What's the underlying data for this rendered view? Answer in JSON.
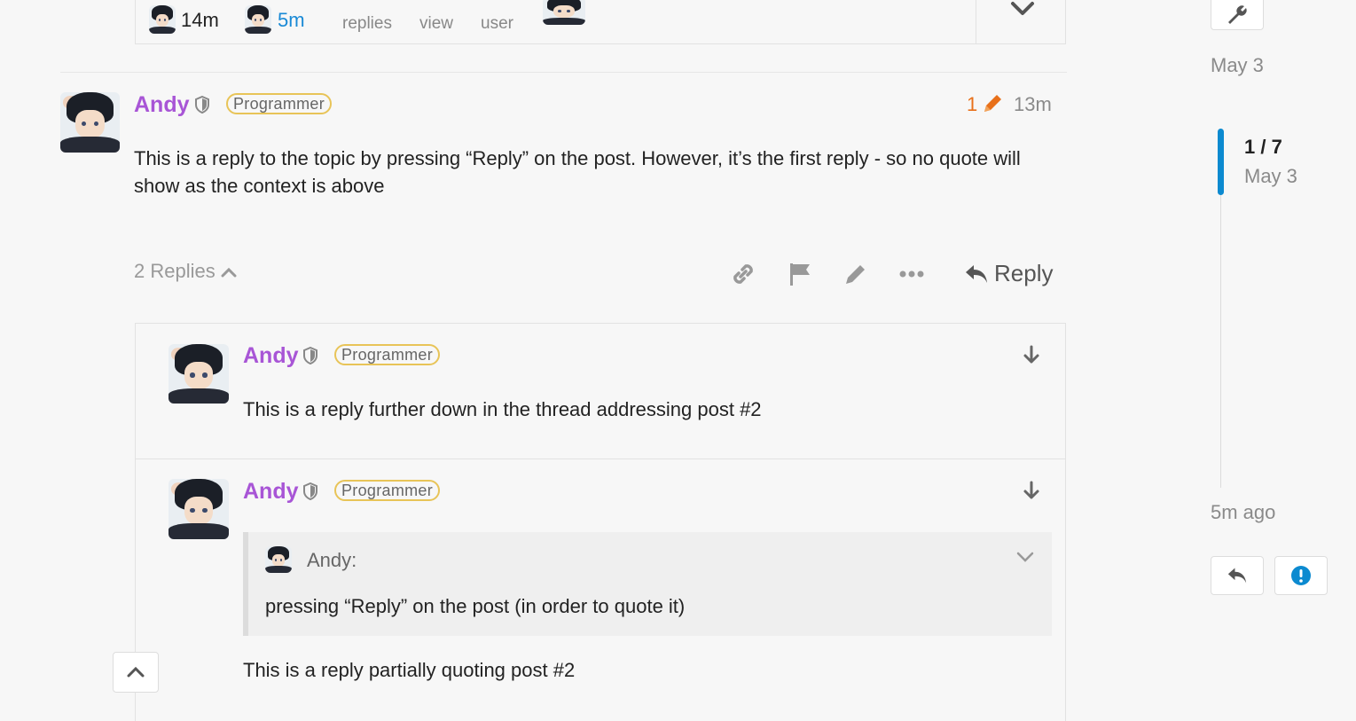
{
  "summary": {
    "created_time": "14m",
    "last_time": "5m",
    "labels": [
      "replies",
      "view",
      "user"
    ]
  },
  "post": {
    "username": "Andy",
    "flair": "Programmer",
    "edit_count": "1",
    "time": "13m",
    "body": "This is a reply to the topic by pressing “Reply” on the post. However, it’s the first reply - so no quote will show as the context is above",
    "replies_toggle": "2 Replies",
    "reply_label": "Reply"
  },
  "replies": [
    {
      "username": "Andy",
      "flair": "Programmer",
      "body": "This is a reply further down in the thread addressing post #2"
    },
    {
      "username": "Andy",
      "flair": "Programmer",
      "quote_author": "Andy:",
      "quote_text": "pressing “Reply” on the post (in order to quote it)",
      "body": "This is a reply partially quoting post #2"
    }
  ],
  "timeline": {
    "start_date": "May 3",
    "position": "1 / 7",
    "position_date": "May 3",
    "end_label": "5m ago"
  },
  "colors": {
    "accent": "#0c8ad0",
    "username": "#a855d6",
    "flair_border": "#e8c458",
    "edit_orange": "#e8701a"
  }
}
